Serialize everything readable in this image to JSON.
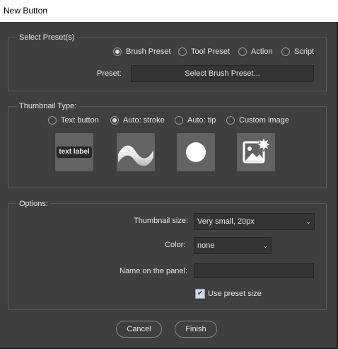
{
  "window": {
    "title": "New Button"
  },
  "preset_group": {
    "legend": "Select Preset(s)",
    "radios": [
      {
        "label": "Brush Preset",
        "checked": true
      },
      {
        "label": "Tool Preset",
        "checked": false
      },
      {
        "label": "Action",
        "checked": false
      },
      {
        "label": "Script",
        "checked": false
      }
    ],
    "preset_label": "Preset:",
    "preset_button": "Select Brush Preset..."
  },
  "thumbnail_group": {
    "legend": "Thumbnail Type:",
    "radios": [
      {
        "label": "Text button",
        "checked": false
      },
      {
        "label": "Auto: stroke",
        "checked": true
      },
      {
        "label": "Auto: tip",
        "checked": false
      },
      {
        "label": "Custom image",
        "checked": false
      }
    ],
    "text_thumb_label": "text label"
  },
  "options_group": {
    "legend": "Options:",
    "thumb_size_label": "Thumbnail size:",
    "thumb_size_value": "Very small, 20px",
    "color_label": "Color:",
    "color_value": "none",
    "name_label": "Name on the panel:",
    "name_value": "",
    "use_preset_size_label": "Use preset size",
    "use_preset_size_checked": true
  },
  "footer": {
    "cancel": "Cancel",
    "finish": "Finish"
  }
}
